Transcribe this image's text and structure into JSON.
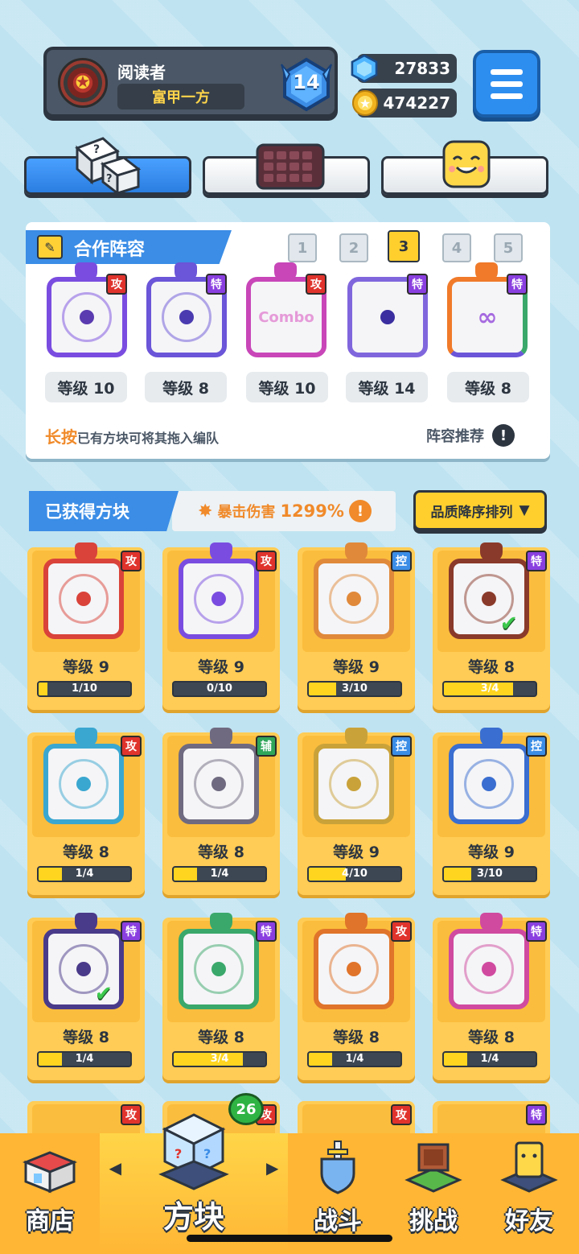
{
  "header": {
    "player_name": "阅读者",
    "player_tag": "富甲一方",
    "rank": "14",
    "gems": "27833",
    "coins": "474227"
  },
  "team": {
    "title": "合作阵容",
    "slots": [
      "1",
      "2",
      "3",
      "4",
      "5"
    ],
    "active_slot": "3",
    "blocks": [
      {
        "tag": "攻",
        "level": "等级 10",
        "color": "#7a4de0"
      },
      {
        "tag": "特",
        "level": "等级 8",
        "color": "#6b55d8"
      },
      {
        "tag": "攻",
        "level": "等级 10",
        "color": "#c846b8",
        "text": "Combo"
      },
      {
        "tag": "特",
        "level": "等级 14",
        "color": "#8066dd"
      },
      {
        "tag": "特",
        "level": "等级 8",
        "color": "#f07a2a"
      }
    ],
    "hint_accent": "长按",
    "hint_rest": "已有方块可将其拖入编队",
    "recommend": "阵容推荐"
  },
  "owned": {
    "title": "已获得方块",
    "crit_label": "暴击伤害",
    "crit_value": "1299%",
    "sort_label": "品质降序排列",
    "cards": [
      {
        "tag": "攻",
        "tag_type": "atk",
        "frame": "#d9433a",
        "level": "等级 9",
        "progress": "1/10",
        "fill": 0.1,
        "check": false
      },
      {
        "tag": "攻",
        "tag_type": "atk",
        "frame": "#7a4de0",
        "level": "等级 9",
        "progress": "0/10",
        "fill": 0.0,
        "check": false
      },
      {
        "tag": "控",
        "tag_type": "ctrl",
        "frame": "#e0893a",
        "level": "等级 9",
        "progress": "3/10",
        "fill": 0.3,
        "check": false
      },
      {
        "tag": "特",
        "tag_type": "spec",
        "frame": "#8a3a2a",
        "level": "等级 8",
        "progress": "3/4",
        "fill": 0.75,
        "check": true
      },
      {
        "tag": "攻",
        "tag_type": "atk",
        "frame": "#3aa7d0",
        "level": "等级 8",
        "progress": "1/4",
        "fill": 0.25,
        "check": false
      },
      {
        "tag": "辅",
        "tag_type": "sup",
        "frame": "#6f6a80",
        "level": "等级 8",
        "progress": "1/4",
        "fill": 0.25,
        "check": false
      },
      {
        "tag": "控",
        "tag_type": "ctrl",
        "frame": "#c9a23a",
        "level": "等级 9",
        "progress": "4/10",
        "fill": 0.4,
        "check": false
      },
      {
        "tag": "控",
        "tag_type": "ctrl",
        "frame": "#3a6ed0",
        "level": "等级 9",
        "progress": "3/10",
        "fill": 0.3,
        "check": false
      },
      {
        "tag": "特",
        "tag_type": "spec",
        "frame": "#4a3a8a",
        "level": "等级 8",
        "progress": "1/4",
        "fill": 0.25,
        "check": true
      },
      {
        "tag": "特",
        "tag_type": "spec",
        "frame": "#3aa86a",
        "level": "等级 8",
        "progress": "3/4",
        "fill": 0.75,
        "check": false
      },
      {
        "tag": "攻",
        "tag_type": "atk",
        "frame": "#e0742a",
        "level": "等级 8",
        "progress": "1/4",
        "fill": 0.25,
        "check": false
      },
      {
        "tag": "特",
        "tag_type": "spec",
        "frame": "#d04aa0",
        "level": "等级 8",
        "progress": "1/4",
        "fill": 0.25,
        "check": false
      }
    ],
    "partial_row_tags": [
      "攻",
      "攻",
      "攻",
      "特"
    ]
  },
  "nav": {
    "shop": "商店",
    "blocks": "方块",
    "battle": "战斗",
    "challenge": "挑战",
    "friends": "好友",
    "blocks_badge": "26"
  }
}
